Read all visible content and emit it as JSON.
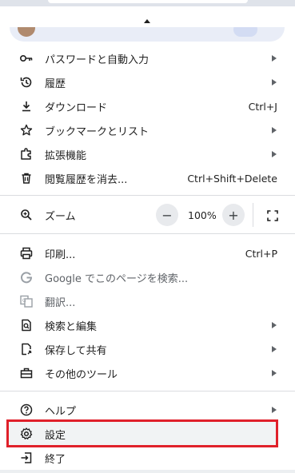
{
  "menu": {
    "items": {
      "passwords": {
        "label": "パスワードと自動入力",
        "icon": "key-icon"
      },
      "history": {
        "label": "履歴",
        "icon": "history-icon"
      },
      "downloads": {
        "label": "ダウンロード",
        "shortcut": "Ctrl+J",
        "icon": "download-icon"
      },
      "bookmarks": {
        "label": "ブックマークとリスト",
        "icon": "star-icon"
      },
      "extensions": {
        "label": "拡張機能",
        "icon": "puzzle-icon"
      },
      "clear": {
        "label": "閲覧履歴を消去...",
        "shortcut": "Ctrl+Shift+Delete",
        "icon": "trash-icon"
      },
      "zoom": {
        "label": "ズーム",
        "minus": "−",
        "value": "100%",
        "plus": "+",
        "icon": "zoom-icon"
      },
      "print": {
        "label": "印刷...",
        "shortcut": "Ctrl+P",
        "icon": "print-icon"
      },
      "google": {
        "label": "Google でこのページを検索...",
        "icon": "google-g-icon"
      },
      "translate": {
        "label": "翻訳...",
        "icon": "translate-icon"
      },
      "find": {
        "label": "検索と編集",
        "icon": "find-icon"
      },
      "save": {
        "label": "保存して共有",
        "icon": "save-share-icon"
      },
      "tools": {
        "label": "その他のツール",
        "icon": "toolbox-icon"
      },
      "help": {
        "label": "ヘルプ",
        "icon": "help-icon"
      },
      "settings": {
        "label": "設定",
        "icon": "gear-icon"
      },
      "exit": {
        "label": "終了",
        "icon": "exit-icon"
      }
    },
    "highlight_color": "#e0202a"
  }
}
